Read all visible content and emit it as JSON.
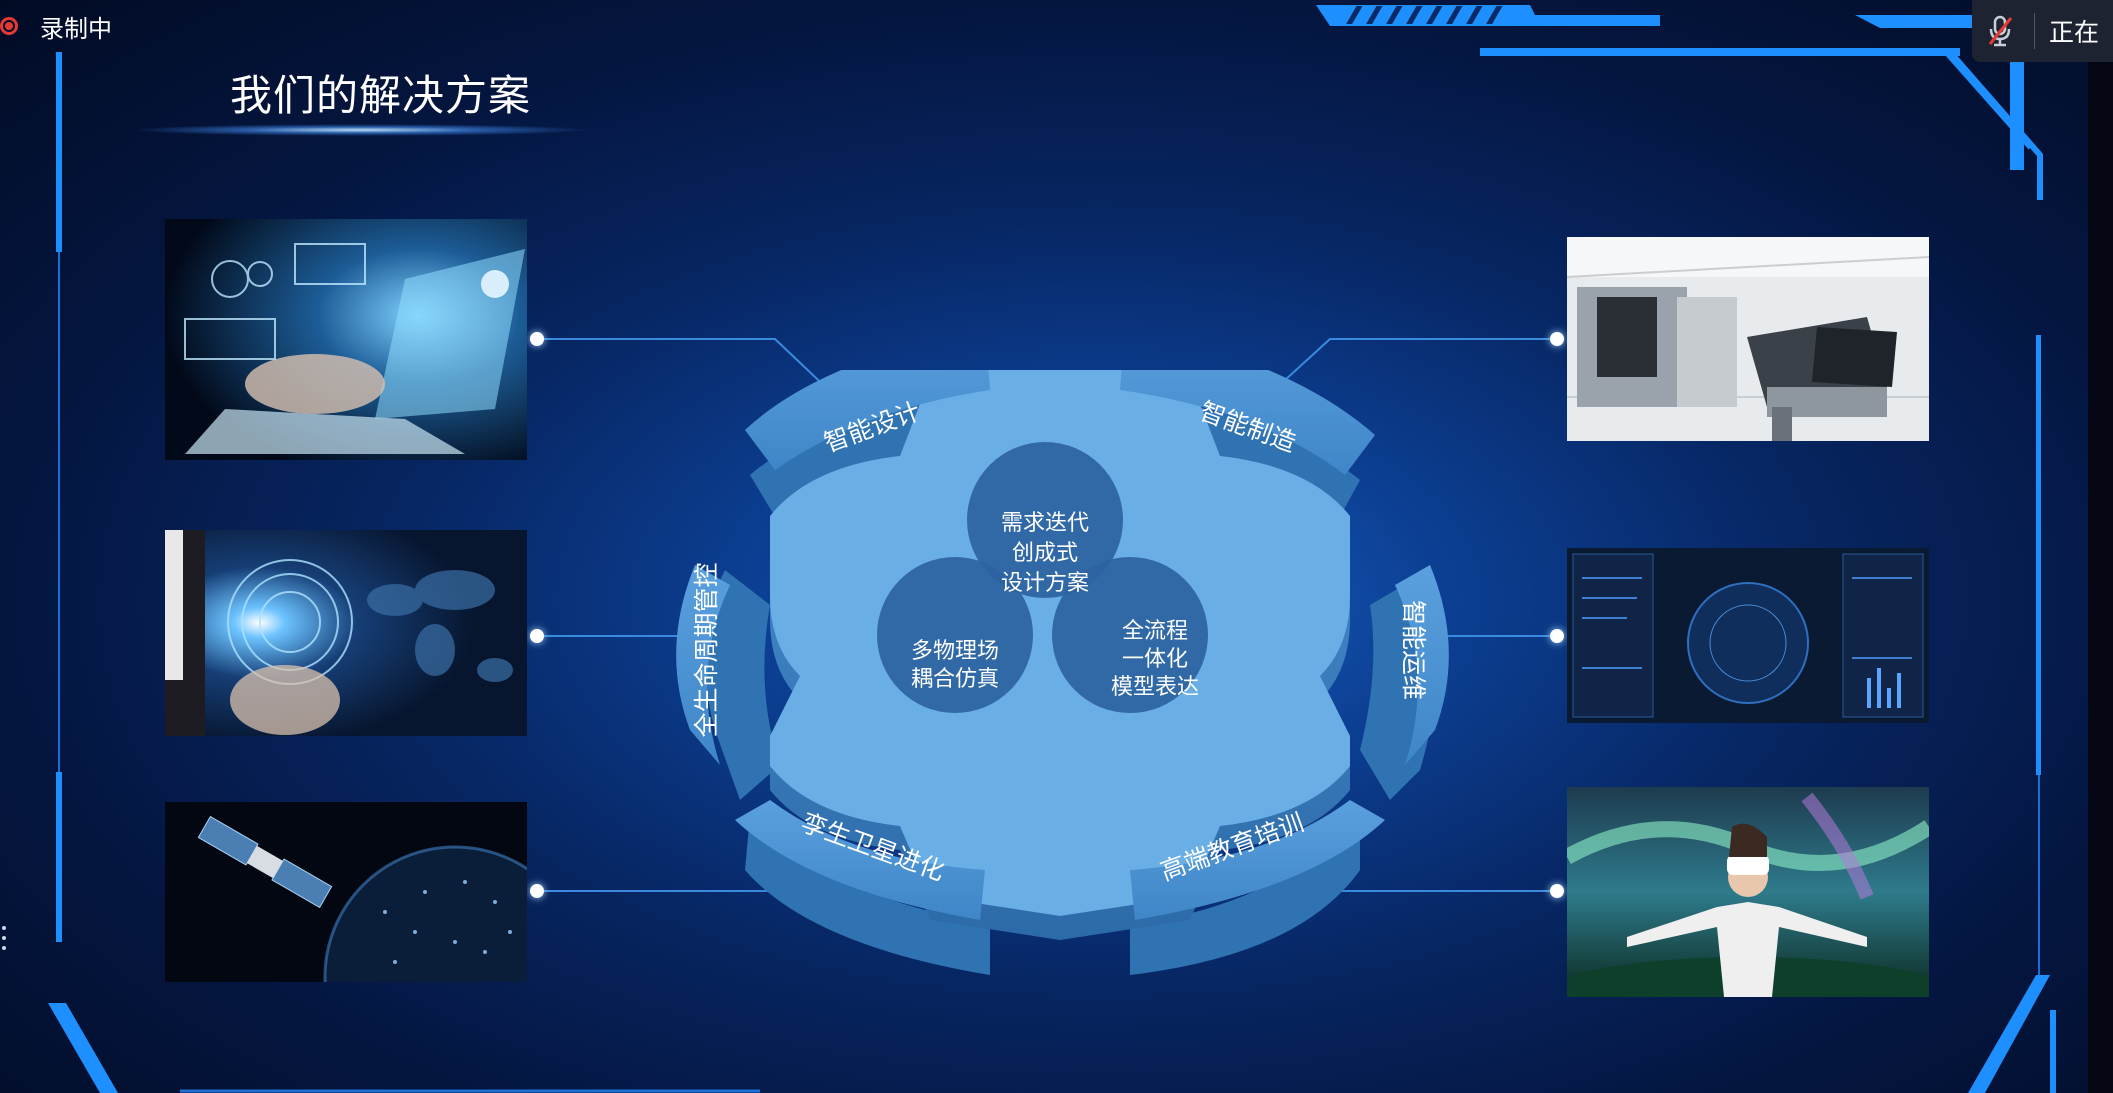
{
  "recording": {
    "label": "录制中"
  },
  "meeting_widget": {
    "status_text": "正在"
  },
  "slide": {
    "title": "我们的解决方案",
    "segments": {
      "top_left": "智能设计",
      "top_right": "智能制造",
      "left": "全生命周期管控",
      "right": "智能运维",
      "bottom_left": "孪生卫星进化",
      "bottom_right": "高端教育培训"
    },
    "circles": {
      "top": [
        "需求迭代",
        "创成式",
        "设计方案"
      ],
      "left": [
        "多物理场",
        "耦合仿真"
      ],
      "right": [
        "全流程",
        "一体化",
        "模型表达"
      ]
    }
  },
  "colors": {
    "accent": "#1e8fff",
    "gear_top": "#6fb0e6",
    "gear_side": "#3f8ccd",
    "circle": "#2b67a8"
  }
}
